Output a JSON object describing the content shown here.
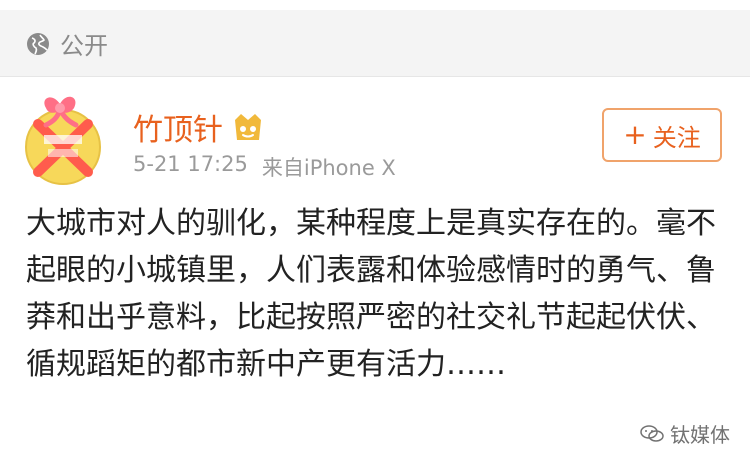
{
  "visibility": {
    "icon": "globe-icon",
    "label": "公开"
  },
  "post": {
    "author": "竹顶针",
    "author_badge_icon": "vip-yellow-badge-icon",
    "timestamp": "5-21 17:25",
    "source": "来自iPhone X",
    "follow_label": "关注",
    "follow_icon": "plus-icon",
    "text": "大城市对人的驯化，某种程度上是真实存在的。毫不起眼的小城镇里，人们表露和体验感情时的勇气、鲁莽和出乎意料，比起按照严密的社交礼节起起伏伏、循规蹈矩的都市新中产更有活力……",
    "colors": {
      "author": "#e8611e",
      "follow_border": "#f0a36b",
      "meta": "#9a9a9a",
      "text": "#222222"
    }
  },
  "watermark": {
    "icon": "wechat-icon",
    "label": "钛媒体"
  }
}
